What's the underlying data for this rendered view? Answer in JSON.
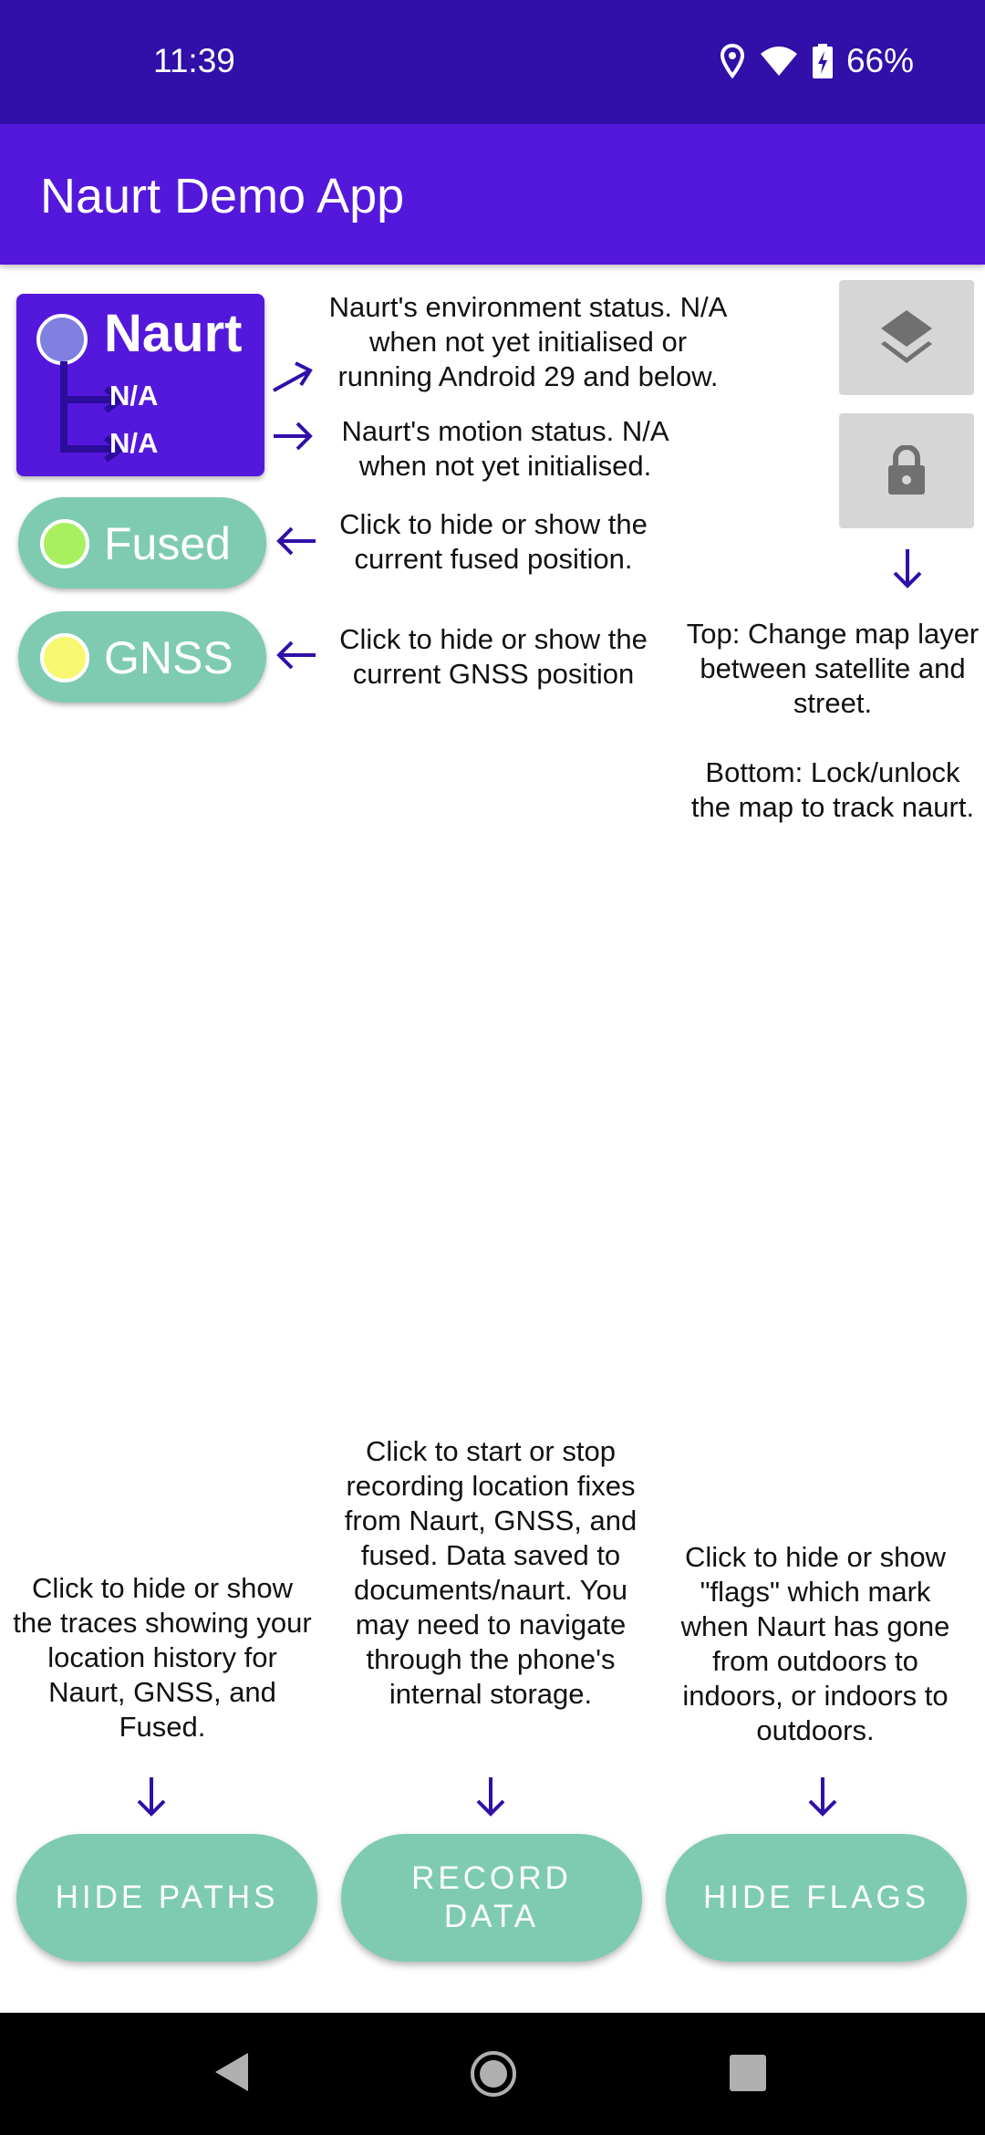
{
  "status_bar": {
    "time": "11:39",
    "battery": "66%",
    "icons": [
      "location-icon",
      "wifi-icon",
      "battery-charging-icon"
    ]
  },
  "app_bar": {
    "title": "Naurt Demo App"
  },
  "naurt_card": {
    "title": "Naurt",
    "environment_status": "N/A",
    "motion_status": "N/A"
  },
  "fused_toggle": {
    "label": "Fused",
    "dot_color": "#a8f060"
  },
  "gnss_toggle": {
    "label": "GNSS",
    "dot_color": "#f8f870"
  },
  "help": {
    "environment": "Naurt's environment status. N/A when not yet initialised or running Android 29 and below.",
    "motion": "Naurt's motion status. N/A when not yet initialised.",
    "fused": "Click to hide or show the current fused position.",
    "gnss": "Click to hide or show the current GNSS position",
    "map_top": "Top: Change map layer between satellite and street.",
    "map_bottom": "Bottom: Lock/unlock the map to track naurt.",
    "paths": "Click to hide or show the traces showing your location history for Naurt, GNSS, and Fused.",
    "record": "Click to start or stop recording location fixes from Naurt, GNSS, and fused. Data saved to documents/naurt. You may need to navigate through the phone's internal storage.",
    "flags": "Click to hide or show \"flags\" which mark when Naurt has gone from outdoors to indoors, or indoors to outdoors."
  },
  "buttons": {
    "hide_paths": "HIDE PATHS",
    "record_data": "RECORD DATA",
    "hide_flags": "HIDE FLAGS"
  },
  "colors": {
    "status_bar": "#3010a8",
    "app_bar": "#5418dc",
    "accent_teal": "#7ecbb2",
    "arrow": "#3010a8"
  }
}
